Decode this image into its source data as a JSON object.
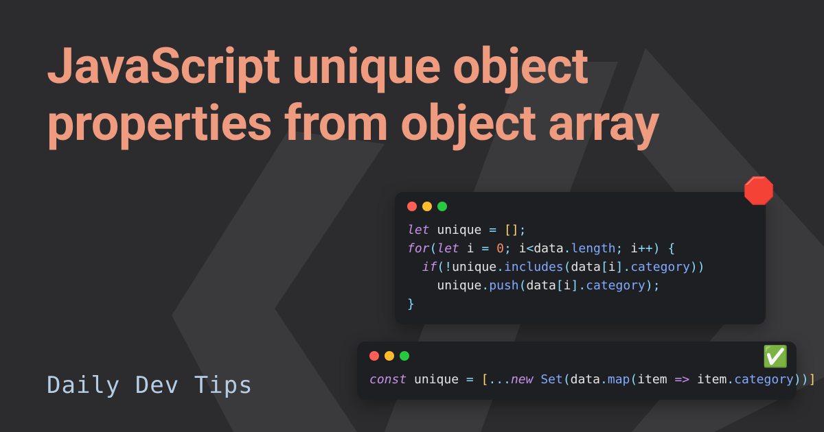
{
  "title": "JavaScript unique object properties from object array",
  "brand": "Daily Dev Tips",
  "badges": {
    "bad": "🛑",
    "good": "✅"
  },
  "code": {
    "bad": {
      "l1_let": "let",
      "l1_var": "unique",
      "l1_eq": "=",
      "l1_open": "[",
      "l1_close": "]",
      "l1_semi": ";",
      "l2_for": "for",
      "l2_paren_o": "(",
      "l2_let": "let",
      "l2_i": "i",
      "l2_eq": "=",
      "l2_zero": "0",
      "l2_semi1": ";",
      "l2_ilt": "i",
      "l2_lt": "<",
      "l2_data": "data",
      "l2_dot1": ".",
      "l2_length": "length",
      "l2_semi2": ";",
      "l2_i2": "i",
      "l2_pp": "++",
      "l2_paren_c": ")",
      "l2_brace_o": "{",
      "l3_if": "if",
      "l3_paren_o": "(",
      "l3_not": "!",
      "l3_unique": "unique",
      "l3_dot1": ".",
      "l3_includes": "includes",
      "l3_paren_o2": "(",
      "l3_data": "data",
      "l3_br_o": "[",
      "l3_i": "i",
      "l3_br_c": "]",
      "l3_dot2": ".",
      "l3_category": "category",
      "l3_paren_c2": ")",
      "l3_paren_c": ")",
      "l4_unique": "unique",
      "l4_dot": ".",
      "l4_push": "push",
      "l4_paren_o": "(",
      "l4_data": "data",
      "l4_br_o": "[",
      "l4_i": "i",
      "l4_br_c": "]",
      "l4_dot2": ".",
      "l4_category": "category",
      "l4_paren_c": ")",
      "l4_semi": ";",
      "l5_brace_c": "}"
    },
    "good": {
      "const": "const",
      "var": "unique",
      "eq": "=",
      "br_o": "[",
      "spread": "...",
      "new": "new",
      "set": "Set",
      "p_o": "(",
      "data": "data",
      "dot": ".",
      "map": "map",
      "p_o2": "(",
      "item": "item",
      "arrow": "=>",
      "item2": "item",
      "dot2": ".",
      "category": "category",
      "p_c2": ")",
      "p_c": ")",
      "br_c": "]"
    }
  }
}
